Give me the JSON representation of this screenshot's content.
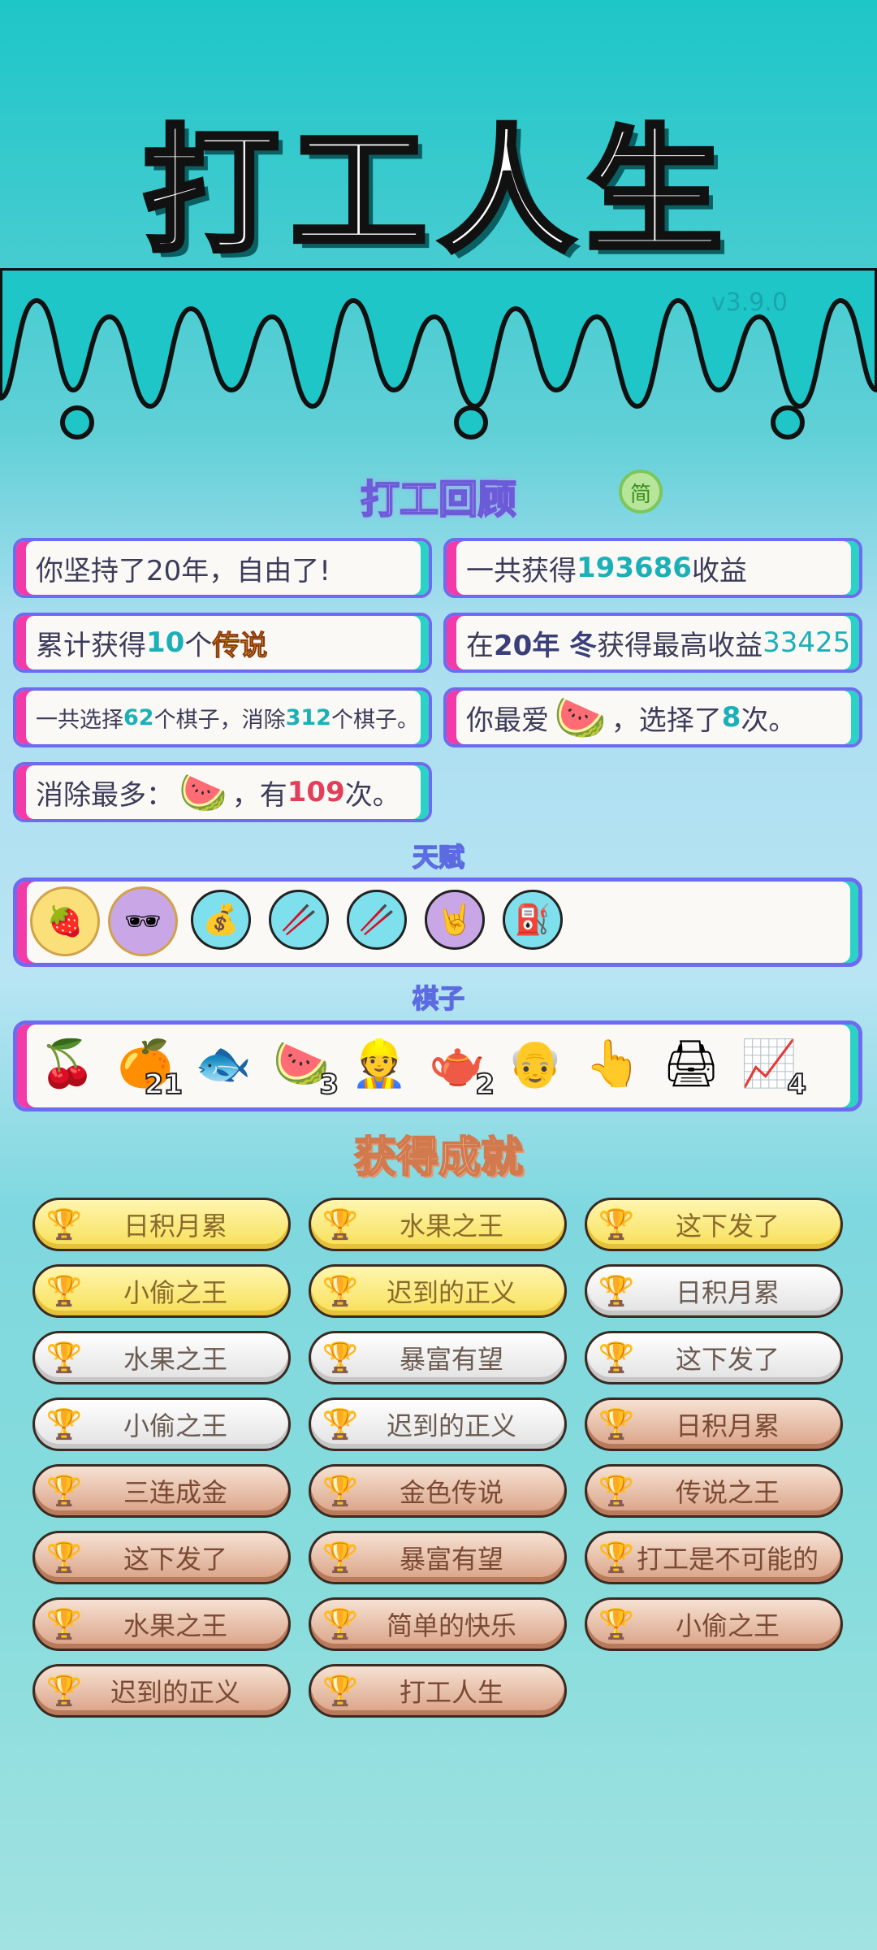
{
  "header": {
    "title": "打工人生",
    "version": "v3.9.0"
  },
  "review": {
    "title": "打工回顾",
    "simp_label": "简",
    "stats": [
      {
        "prefix": "你坚持了20年，自由了!",
        "value": "",
        "suffix": ""
      },
      {
        "prefix": "一共获得",
        "value": "193686",
        "suffix": "收益"
      },
      {
        "prefix": "累计获得",
        "value": "10",
        "mid": "个",
        "highlight": "传说"
      },
      {
        "prefix": "在 ",
        "year": "20年 冬",
        "mid": " 获得最高收益",
        "value": "33425"
      },
      {
        "prefix": "一共选择",
        "v1": "62",
        "mid": "个棋子，消除",
        "v2": "312",
        "suffix": "个棋子。"
      },
      {
        "prefix": "你最爱",
        "icon": "watermelon-icon",
        "mid": "，选择了",
        "value": "8",
        "suffix": "次。"
      },
      {
        "prefix": "消除最多：",
        "icon": "watermelon-icon",
        "mid": "，有",
        "value": "109",
        "suffix": "次。"
      }
    ]
  },
  "talents": {
    "title": "天赋",
    "items": [
      "fruit-bowl-icon",
      "sunglasses-fruit-icon",
      "sack-icon",
      "chopsticks-icon",
      "chopsticks-icon",
      "rock-hand-icon",
      "pump-icon"
    ]
  },
  "pieces": {
    "title": "棋子",
    "items": [
      {
        "icon": "longan-icon",
        "count": ""
      },
      {
        "icon": "orange-icon",
        "count": "21"
      },
      {
        "icon": "koi-icon",
        "count": ""
      },
      {
        "icon": "watermelon-icon",
        "count": "3"
      },
      {
        "icon": "worker-icon",
        "count": ""
      },
      {
        "icon": "teapot-icon",
        "count": "2"
      },
      {
        "icon": "old-man-icon",
        "count": ""
      },
      {
        "icon": "pointing-hand-icon",
        "count": ""
      },
      {
        "icon": "printer-icon",
        "count": ""
      },
      {
        "icon": "chart-up-icon",
        "count": "4"
      }
    ]
  },
  "achievements": {
    "title": "获得成就",
    "items": [
      {
        "label": "日积月累",
        "tier": "gold"
      },
      {
        "label": "水果之王",
        "tier": "gold"
      },
      {
        "label": "这下发了",
        "tier": "gold"
      },
      {
        "label": "小偷之王",
        "tier": "gold"
      },
      {
        "label": "迟到的正义",
        "tier": "gold"
      },
      {
        "label": "日积月累",
        "tier": "silver"
      },
      {
        "label": "水果之王",
        "tier": "silver"
      },
      {
        "label": "暴富有望",
        "tier": "silver"
      },
      {
        "label": "这下发了",
        "tier": "silver"
      },
      {
        "label": "小偷之王",
        "tier": "silver"
      },
      {
        "label": "迟到的正义",
        "tier": "silver"
      },
      {
        "label": "日积月累",
        "tier": "bronze"
      },
      {
        "label": "三连成金",
        "tier": "bronze"
      },
      {
        "label": "金色传说",
        "tier": "bronze"
      },
      {
        "label": "传说之王",
        "tier": "bronze"
      },
      {
        "label": "这下发了",
        "tier": "bronze"
      },
      {
        "label": "暴富有望",
        "tier": "bronze"
      },
      {
        "label": "打工是不可能的",
        "tier": "bronze"
      },
      {
        "label": "水果之王",
        "tier": "bronze"
      },
      {
        "label": "简单的快乐",
        "tier": "bronze"
      },
      {
        "label": "小偷之王",
        "tier": "bronze"
      },
      {
        "label": "迟到的正义",
        "tier": "bronze"
      },
      {
        "label": "打工人生",
        "tier": "bronze"
      }
    ]
  }
}
